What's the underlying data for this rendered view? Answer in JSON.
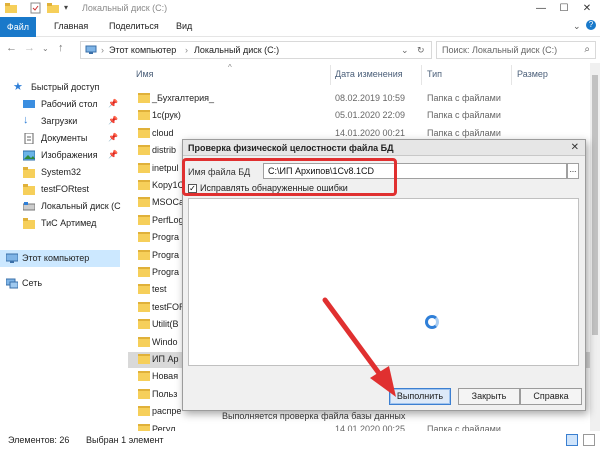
{
  "titlebar": {
    "title": "Локальный диск (C:)"
  },
  "ribbon": {
    "tabs": [
      "Файл",
      "Главная",
      "Поделиться",
      "Вид"
    ]
  },
  "address": {
    "segments": [
      "Этот компьютер",
      "Локальный диск (C:)"
    ],
    "search_placeholder": "Поиск: Локальный диск (C:)"
  },
  "nav": {
    "items": [
      {
        "label": "Быстрый доступ",
        "icon": "star-icon"
      },
      {
        "label": "Рабочий стол",
        "icon": "desktop-icon",
        "pinned": true
      },
      {
        "label": "Загрузки",
        "icon": "download-icon",
        "pinned": true
      },
      {
        "label": "Документы",
        "icon": "documents-icon",
        "pinned": true
      },
      {
        "label": "Изображения",
        "icon": "pictures-icon",
        "pinned": true
      },
      {
        "label": "System32",
        "icon": "folder-icon"
      },
      {
        "label": "testFORtest",
        "icon": "folder-icon"
      },
      {
        "label": "Локальный диск (C",
        "icon": "drive-icon"
      },
      {
        "label": "ТиС Артимед",
        "icon": "folder-icon"
      },
      {
        "label": "Этот компьютер",
        "icon": "computer-icon",
        "selected": true
      },
      {
        "label": "Сеть",
        "icon": "network-icon"
      }
    ]
  },
  "filelist": {
    "columns": [
      "Имя",
      "Дата изменения",
      "Тип",
      "Размер"
    ],
    "rows": [
      {
        "name": "_Бухгалтерия_",
        "date": "08.02.2019 10:59",
        "type": "Папка с файлами"
      },
      {
        "name": "1с(рук)",
        "date": "05.01.2020 22:09",
        "type": "Папка с файлами"
      },
      {
        "name": "cloud",
        "date": "14.01.2020 00:21",
        "type": "Папка с файлами"
      },
      {
        "name": "distrib",
        "date": "",
        "type": ""
      },
      {
        "name": "inetpul",
        "date": "",
        "type": ""
      },
      {
        "name": "Kopy1C",
        "date": "",
        "type": ""
      },
      {
        "name": "MSOCa",
        "date": "",
        "type": ""
      },
      {
        "name": "PerfLog",
        "date": "",
        "type": ""
      },
      {
        "name": "Progra",
        "date": "",
        "type": ""
      },
      {
        "name": "Progra",
        "date": "",
        "type": ""
      },
      {
        "name": "Progra",
        "date": "",
        "type": ""
      },
      {
        "name": "test",
        "date": "",
        "type": ""
      },
      {
        "name": "testFOR",
        "date": "",
        "type": ""
      },
      {
        "name": "Utilit(B",
        "date": "",
        "type": ""
      },
      {
        "name": "Windo",
        "date": "",
        "type": ""
      },
      {
        "name": "ИП Ар",
        "date": "",
        "type": "",
        "selected": true
      },
      {
        "name": "Новая",
        "date": "",
        "type": ""
      },
      {
        "name": "Польз",
        "date": "",
        "type": ""
      },
      {
        "name": "распре",
        "date": "",
        "type": ""
      },
      {
        "name": "Регул",
        "date": "14.01.2020 00:25",
        "type": "Папка с файлами"
      }
    ]
  },
  "status": {
    "count": "Элементов: 26",
    "selected": "Выбран 1 элемент"
  },
  "dialog": {
    "title": "Проверка физической целостности файла БД",
    "file_label": "Имя файла БД",
    "file_path": "C:\\ИП Архипов\\1Cv8.1CD",
    "browse_label": "...",
    "checkbox_label": "Исправлять обнаруженные ошибки",
    "checkbox_checked": true,
    "status_text": "Выполняется проверка файла базы данных",
    "buttons": {
      "run": "Выполнить",
      "close": "Закрыть",
      "help": "Справка"
    }
  },
  "colors": {
    "accent": "#1979ca",
    "annotation": "#e03030",
    "selection": "#cce8ff"
  }
}
